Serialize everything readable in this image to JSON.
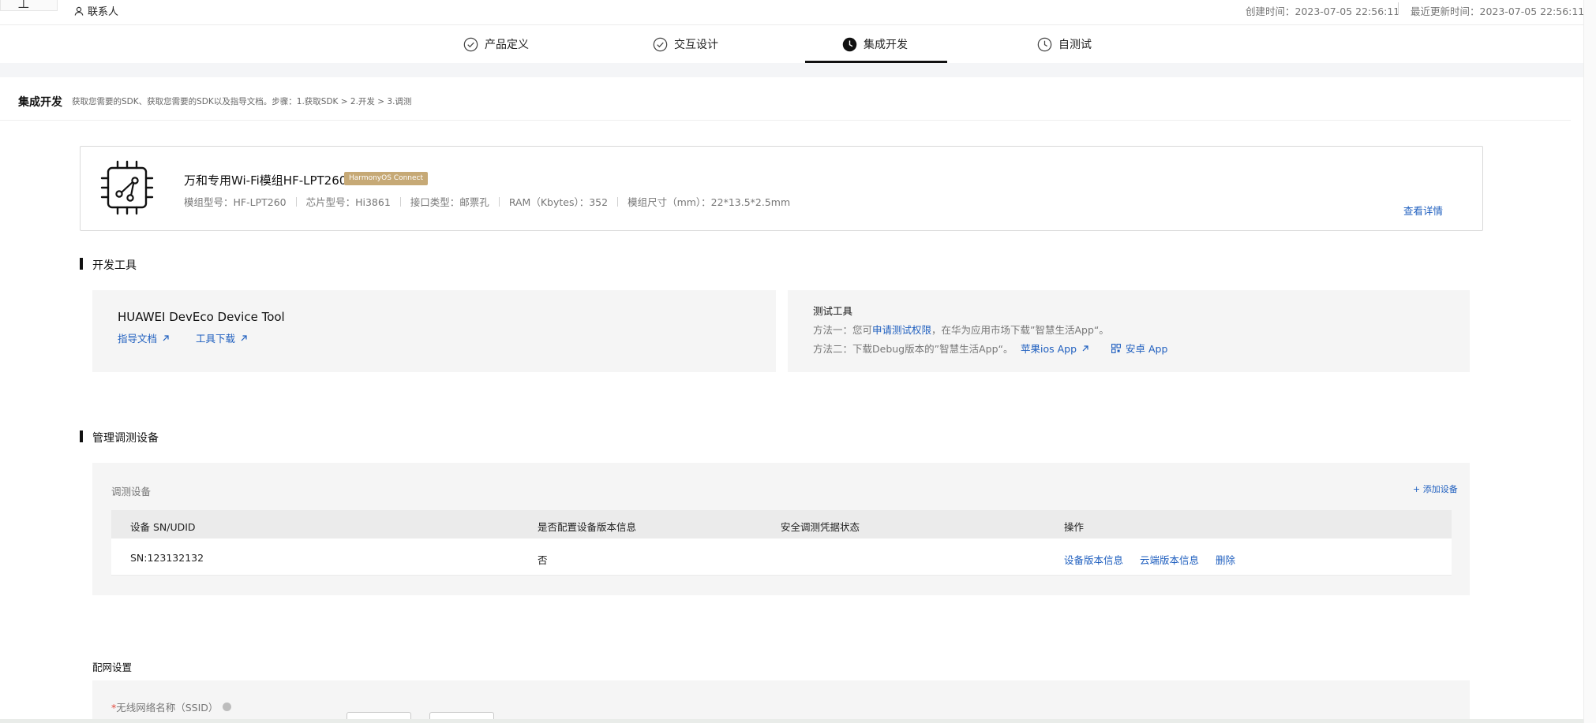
{
  "topbar": {
    "contact": "联系人",
    "created": "创建时间：2023-07-05 22:56:11",
    "updated": "最近更新时间：2023-07-05 22:56:11"
  },
  "steps": [
    {
      "label": "产品定义",
      "state": "done"
    },
    {
      "label": "交互设计",
      "state": "done"
    },
    {
      "label": "集成开发",
      "state": "active"
    },
    {
      "label": "自测试",
      "state": "pending"
    }
  ],
  "header": {
    "title": "集成开发",
    "description": "获取您需要的SDK、获取您需要的SDK以及指导文档。步骤：1.获取SDK > 2.开发 > 3.调测"
  },
  "module": {
    "name": "万和专用Wi-Fi模组HF-LPT260",
    "badge": "HarmonyOS Connect",
    "specs": [
      "模组型号：HF-LPT260",
      "芯片型号：Hi3861",
      "接口类型：邮票孔",
      "RAM（Kbytes）：352",
      "模组尺寸（mm）：22*13.5*2.5mm"
    ],
    "detail_link": "查看详情"
  },
  "dev_tools": {
    "section_title": "开发工具",
    "tool_name": "HUAWEI DevEco Device Tool",
    "doc_link": "指导文档",
    "download_link": "工具下载",
    "test_title": "测试工具",
    "method1_prefix": "方法一：您可",
    "method1_link": "申请测试权限",
    "method1_suffix": "，在华为应用市场下载”智慧生活App“。",
    "method2_prefix": "方法二：下载Debug版本的”智慧生活App“。",
    "ios_link": "苹果ios App",
    "android_link": "安卓 App"
  },
  "devices": {
    "section_title": "管理调测设备",
    "panel_label": "调测设备",
    "add_button": "+ 添加设备",
    "columns": [
      "设备 SN/UDID",
      "是否配置设备版本信息",
      "安全调测凭据状态",
      "操作"
    ],
    "rows": [
      {
        "sn": "SN:123132132",
        "configured": "否",
        "cred_status": "",
        "actions": [
          "设备版本信息",
          "云端版本信息",
          "删除"
        ]
      }
    ]
  },
  "network": {
    "section_title": "配网设置",
    "ssid_required": "*",
    "ssid_label": "无线网络名称（SSID）"
  },
  "colors": {
    "link": "#1f5fbf",
    "badge": "#c6a976",
    "panel": "#f5f5f5"
  }
}
